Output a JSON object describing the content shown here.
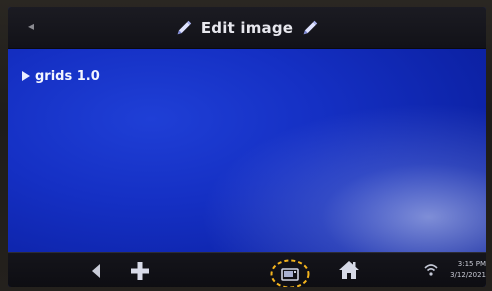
{
  "header": {
    "title": "Edit image"
  },
  "tree": {
    "items": [
      {
        "label": "grids 1.0"
      }
    ]
  },
  "status": {
    "time": "3:15 PM",
    "date": "3/12/2021"
  },
  "colors": {
    "screen_blue": "#1530c4",
    "bar_dark": "#121218",
    "highlight_circle": "#f5b51e"
  },
  "icons": {
    "title_left": "pencil-icon",
    "title_right": "pencil-icon",
    "tree": "triangle-right-icon",
    "back": "chevron-left-icon",
    "add": "plus-icon",
    "media": "image-icon",
    "home": "home-icon",
    "wifi": "wifi-icon"
  }
}
